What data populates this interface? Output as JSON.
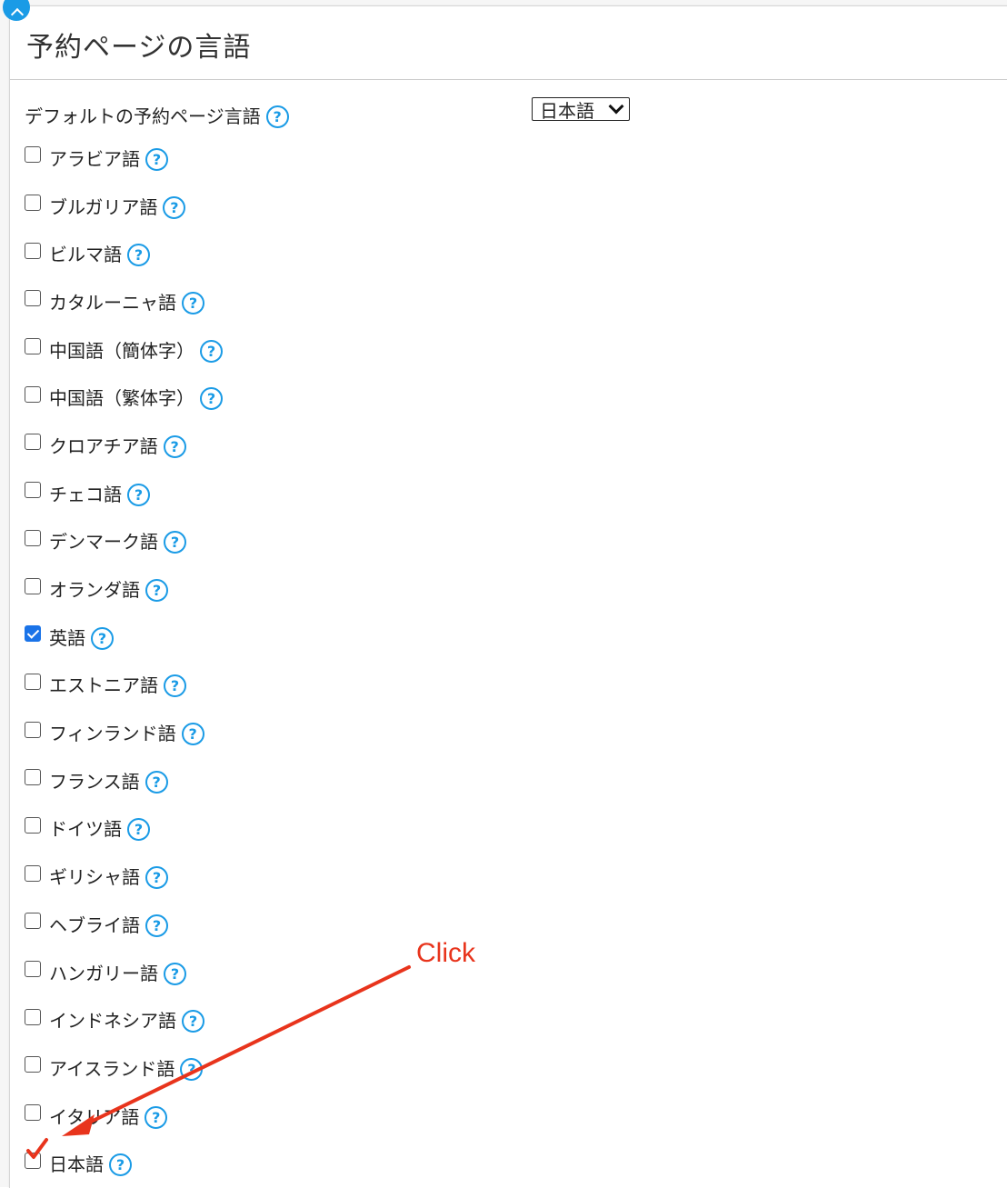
{
  "panel": {
    "title": "予約ページの言語"
  },
  "default_language": {
    "label": "デフォルトの予約ページ言語",
    "selected": "日本語"
  },
  "help_glyph": "?",
  "languages": [
    {
      "label": "アラビア語",
      "checked": false
    },
    {
      "label": "ブルガリア語",
      "checked": false
    },
    {
      "label": "ビルマ語",
      "checked": false
    },
    {
      "label": "カタルーニャ語",
      "checked": false
    },
    {
      "label": "中国語（簡体字）",
      "checked": false
    },
    {
      "label": "中国語（繁体字）",
      "checked": false
    },
    {
      "label": "クロアチア語",
      "checked": false
    },
    {
      "label": "チェコ語",
      "checked": false
    },
    {
      "label": "デンマーク語",
      "checked": false
    },
    {
      "label": "オランダ語",
      "checked": false
    },
    {
      "label": "英語",
      "checked": true
    },
    {
      "label": "エストニア語",
      "checked": false
    },
    {
      "label": "フィンランド語",
      "checked": false
    },
    {
      "label": "フランス語",
      "checked": false
    },
    {
      "label": "ドイツ語",
      "checked": false
    },
    {
      "label": "ギリシャ語",
      "checked": false
    },
    {
      "label": "ヘブライ語",
      "checked": false
    },
    {
      "label": "ハンガリー語",
      "checked": false
    },
    {
      "label": "インドネシア語",
      "checked": false
    },
    {
      "label": "アイスランド語",
      "checked": false
    },
    {
      "label": "イタリア語",
      "checked": false
    },
    {
      "label": "日本語",
      "checked": false
    }
  ],
  "annotation": {
    "text": "Click",
    "color": "#e8341c"
  },
  "colors": {
    "help_icon": "#1a9be6",
    "checkbox_checked": "#1a73e8"
  }
}
